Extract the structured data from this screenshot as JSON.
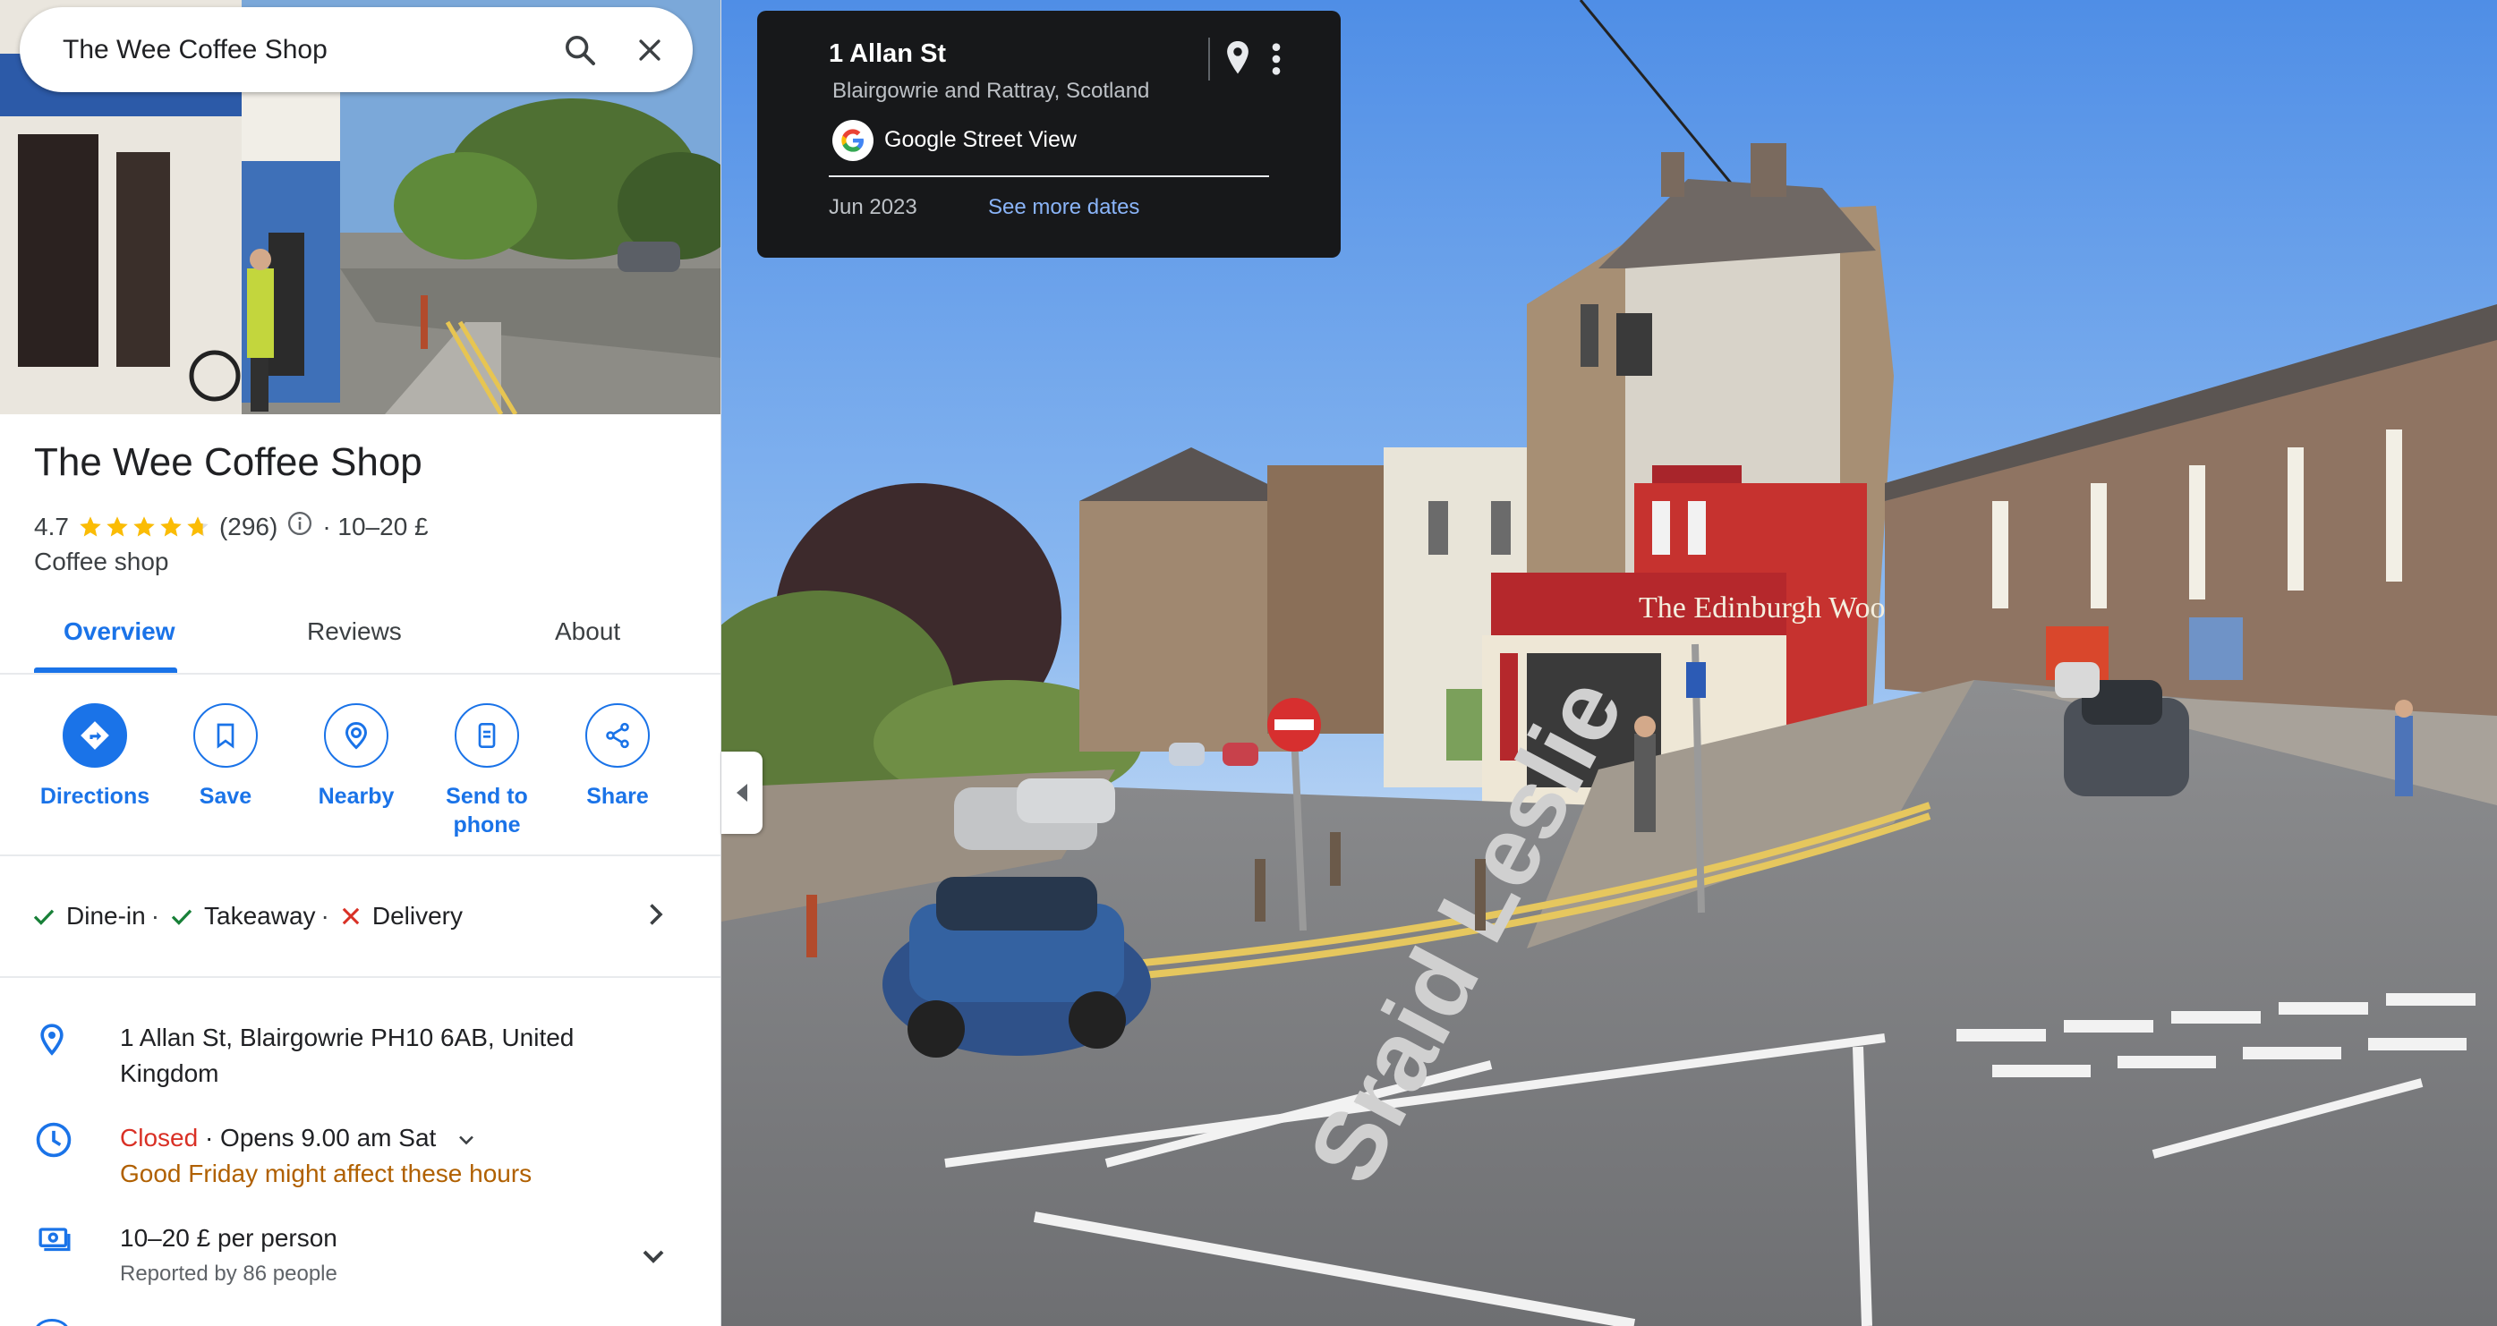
{
  "search": {
    "query": "The Wee Coffee Shop"
  },
  "place": {
    "name": "The Wee Coffee Shop",
    "rating": "4.7",
    "rating_value": 4.7,
    "review_count": "(296)",
    "price": "· 10–20 £",
    "category": "Coffee shop"
  },
  "tabs": [
    "Overview",
    "Reviews",
    "About"
  ],
  "actions": {
    "directions": "Directions",
    "save": "Save",
    "nearby": "Nearby",
    "send_line1": "Send to",
    "send_line2": "phone",
    "share": "Share"
  },
  "services": {
    "dine_in": "Dine-in",
    "takeaway": "Takeaway",
    "delivery": "Delivery",
    "sep": "·"
  },
  "address": {
    "line1": "1 Allan St, Blairgowrie PH10 6AB, United",
    "line2": "Kingdom"
  },
  "hours": {
    "status": "Closed",
    "opens": "· Opens 9.00 am Sat",
    "notice": "Good Friday might affect these hours"
  },
  "pricing": {
    "range": "10–20 £ per person",
    "reported": "Reported by 86 people"
  },
  "streetview": {
    "address": "1 Allan St",
    "locality": "Blairgowrie and Rattray, Scotland",
    "provider": "Google Street View",
    "date": "Jun 2023",
    "more_dates": "See more dates",
    "shop_sign": "The Edinburgh Woollen Mill",
    "road_text": "Sraid Leslie"
  },
  "colors": {
    "accent": "#1a73e8",
    "closed": "#d93025",
    "warning": "#b06000",
    "star": "#fbbc04",
    "check": "#188038",
    "card_bg": "#17181a"
  },
  "icons": {
    "search": "search-icon",
    "close": "close-icon",
    "directions": "directions-icon",
    "save": "bookmark-icon",
    "nearby": "nearby-icon",
    "send": "phone-icon",
    "share": "share-icon",
    "pin": "location-pin-icon",
    "clock": "clock-icon",
    "money": "money-icon",
    "check": "check-icon",
    "cross": "cross-icon",
    "chevron": "chevron-right-icon",
    "expand": "chevron-down-icon",
    "kebab": "more-vert-icon"
  }
}
